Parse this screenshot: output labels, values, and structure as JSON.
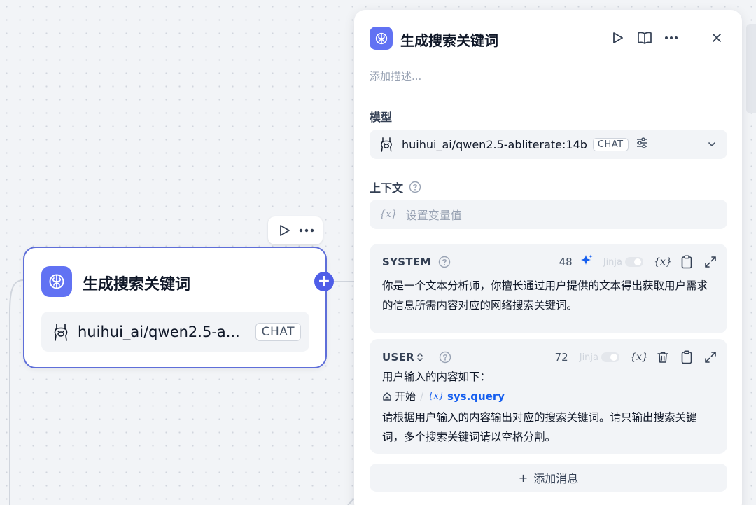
{
  "node": {
    "title": "生成搜索关键词",
    "model_name": "huihui_ai/qwen2.5-a...",
    "model_badge": "CHAT"
  },
  "panel": {
    "title": "生成搜索关键词",
    "description_placeholder": "添加描述...",
    "model_label": "模型",
    "model_name": "huihui_ai/qwen2.5-abliterate:14b",
    "model_badge": "CHAT",
    "context_label": "上下文",
    "context_var_symbol": "{x}",
    "context_placeholder": "设置变量值",
    "messages": [
      {
        "role": "SYSTEM",
        "count": "48",
        "jinja_label": "Jinja",
        "text": "你是一个文本分析师，你擅长通过用户提供的文本得出获取用户需求的信息所需内容对应的网络搜索关键词。"
      },
      {
        "role": "USER",
        "count": "72",
        "jinja_label": "Jinja",
        "line1": "用户输入的内容如下：",
        "chip_node": "开始",
        "chip_sep": "/",
        "chip_var_symbol": "{x}",
        "chip_var": "sys.query",
        "line2": "请根据用户输入的内容输出对应的搜索关键词。请只输出搜索关键词，多个搜索关键词请以空格分割。"
      }
    ],
    "add_message_label": "添加消息",
    "add_message_icon": "+"
  },
  "icons": {
    "brand_accent": "#6172f3",
    "node_border": "#5e6ed9",
    "var_link": "#155eef"
  }
}
